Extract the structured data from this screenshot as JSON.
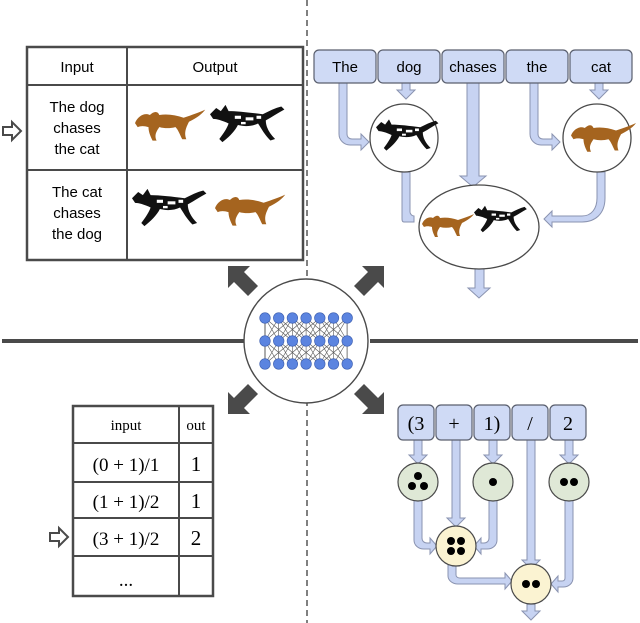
{
  "colors": {
    "token_fill": "#cfdaf5",
    "token_stroke": "#5a5f6e",
    "flow_fill": "#c7d3f2",
    "flow_stroke": "#8a93b0",
    "leaf_node_fill": "#dfe8d6",
    "combine_node_fill": "#fbf3d2",
    "neuron": "#5b84e0",
    "dark": "#4a4a4a",
    "cat": "#a5641f",
    "dog": "#111111"
  },
  "top_left": {
    "headers": [
      "Input",
      "Output"
    ],
    "rows": [
      {
        "input_lines": [
          "The dog",
          "chases",
          "the cat"
        ],
        "output": [
          "cat",
          "dog"
        ],
        "selected": true
      },
      {
        "input_lines": [
          "The cat",
          "chases",
          "the dog"
        ],
        "output": [
          "dog",
          "cat"
        ],
        "selected": false
      }
    ]
  },
  "top_right": {
    "tokens": [
      "The",
      "dog",
      "chases",
      "the",
      "cat"
    ],
    "nodes": [
      {
        "id": "dog-node",
        "depicts": "dog"
      },
      {
        "id": "cat-node",
        "depicts": "cat"
      },
      {
        "id": "root-node",
        "depicts": [
          "cat",
          "dog"
        ]
      }
    ]
  },
  "center": {
    "network": {
      "layers": 3,
      "neurons_per_layer": 7,
      "icon": "neural-network-icon"
    }
  },
  "bottom_left": {
    "headers": [
      "input",
      "out"
    ],
    "rows": [
      {
        "input": "(0 + 1)/1",
        "out": "1",
        "selected": false
      },
      {
        "input": "(1 + 1)/2",
        "out": "1",
        "selected": false
      },
      {
        "input": "(3 + 1)/2",
        "out": "2",
        "selected": true
      },
      {
        "input": "...",
        "out": "",
        "selected": false
      }
    ]
  },
  "bottom_right": {
    "tokens": [
      "(3",
      "+",
      "1)",
      "/",
      "2"
    ],
    "nodes": [
      {
        "id": "three",
        "dots": 3,
        "kind": "leaf"
      },
      {
        "id": "one",
        "dots": 1,
        "kind": "leaf"
      },
      {
        "id": "two",
        "dots": 2,
        "kind": "leaf"
      },
      {
        "id": "sum",
        "dots": 4,
        "kind": "combine"
      },
      {
        "id": "result",
        "dots": 2,
        "kind": "combine"
      }
    ]
  }
}
